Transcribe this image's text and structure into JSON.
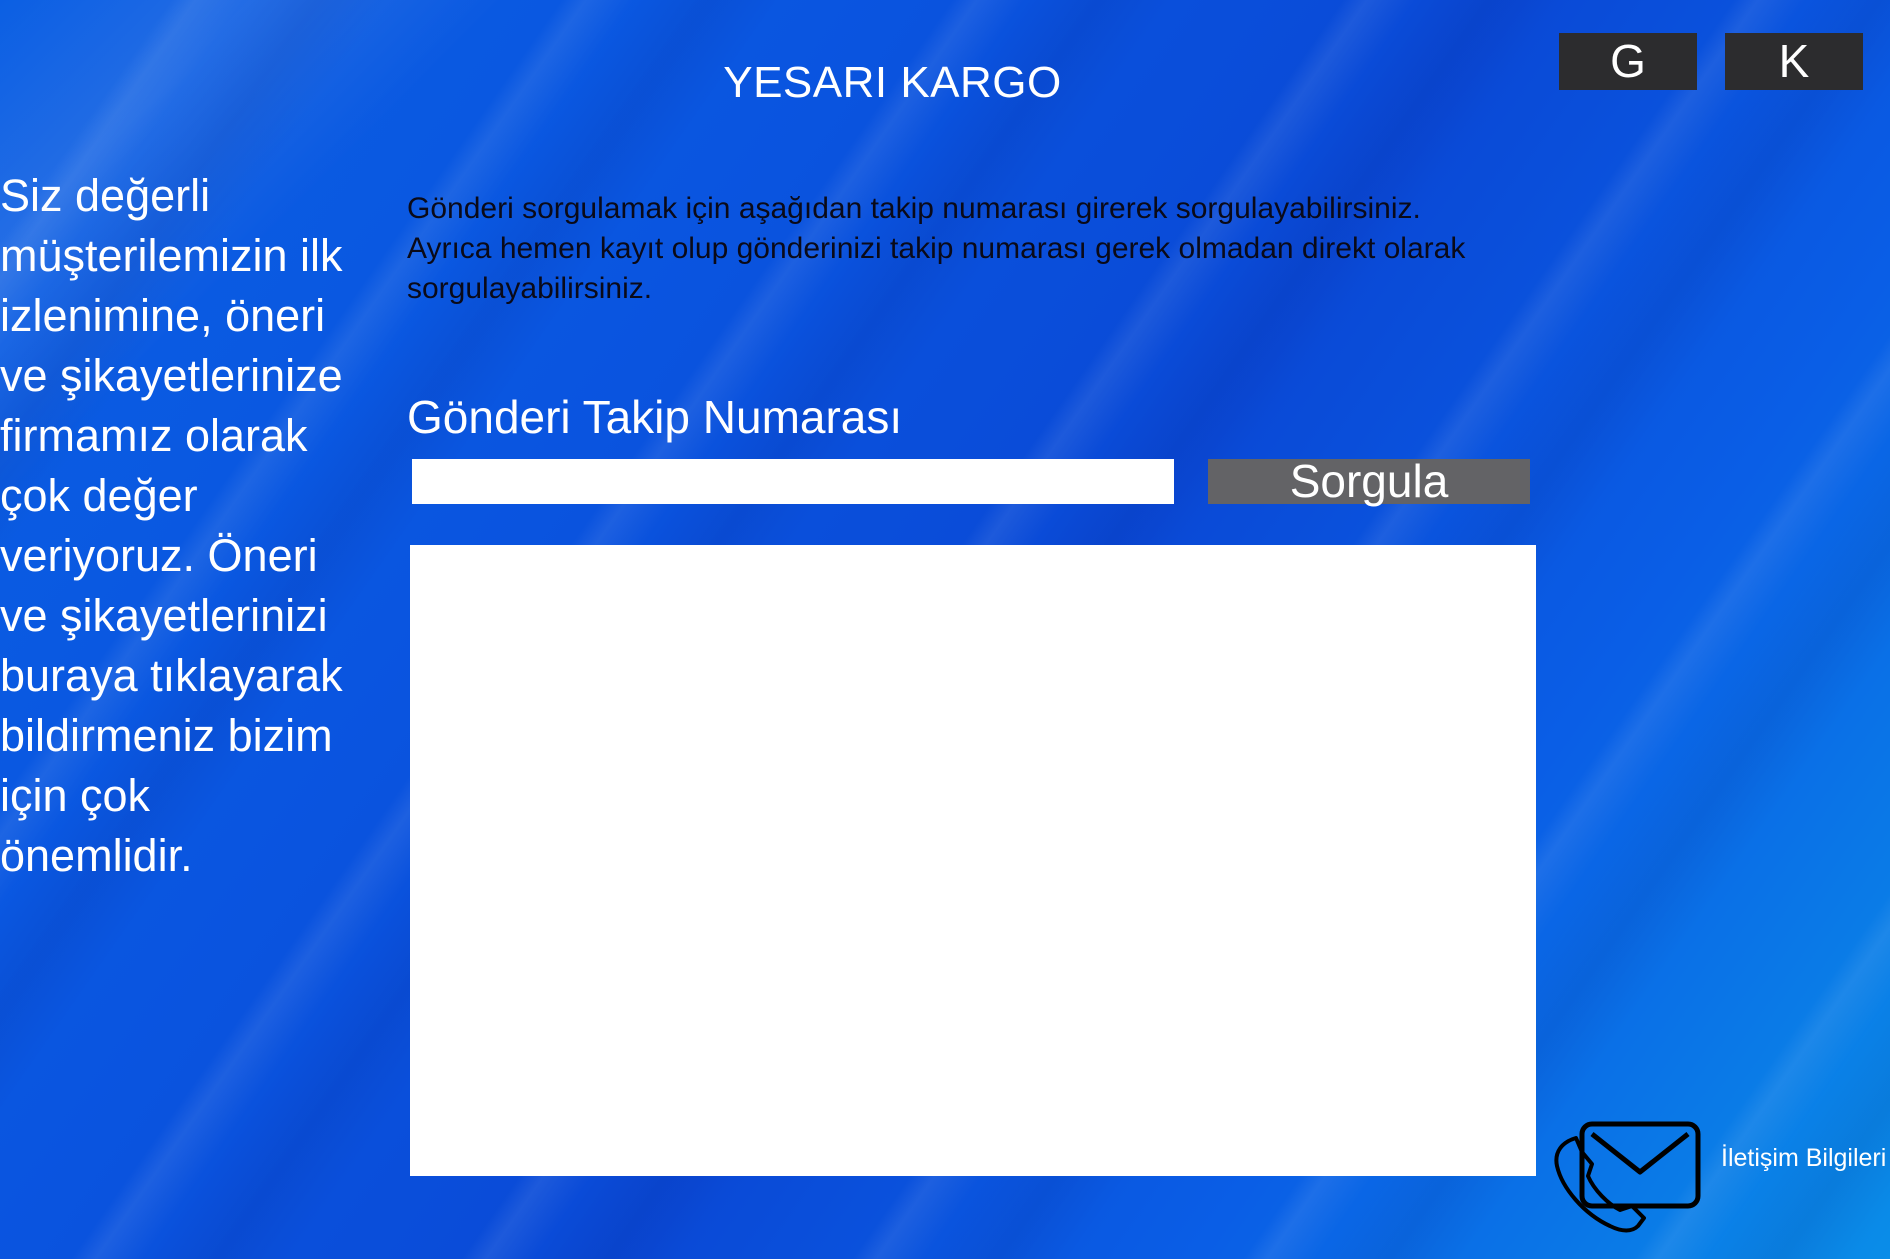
{
  "header": {
    "brand": "YESARI KARGO",
    "lang_buttons": [
      "G",
      "K"
    ]
  },
  "sidebar": {
    "message": "Siz değerli müşterilemizin ilk izlenimine, öneri ve şikayetlerinize firmamız olarak çok değer veriyoruz. Öneri ve şikayetlerinizi buraya tıklayarak bildirmeniz bizim için çok önemlidir."
  },
  "main": {
    "info_line1": "Gönderi sorgulamak için aşağıdan takip numarası girerek sorgulayabilirsiniz.",
    "info_line2": "Ayrıca hemen kayıt olup gönderinizi takip numarası gerek olmadan direkt olarak",
    "info_line3": "sorgulayabilirsiniz.",
    "tracking_label": "Gönderi Takip Numarası",
    "tracking_value": "",
    "query_button": "Sorgula"
  },
  "footer": {
    "contact_label": "İletişim Bilgileri",
    "contact_icon": "envelope-phone-icon"
  },
  "colors": {
    "background": "#0a55e0",
    "lang_button": "#2c2c2e",
    "query_button": "#636366",
    "panel": "#ffffff",
    "info_text": "#0a0a18"
  }
}
